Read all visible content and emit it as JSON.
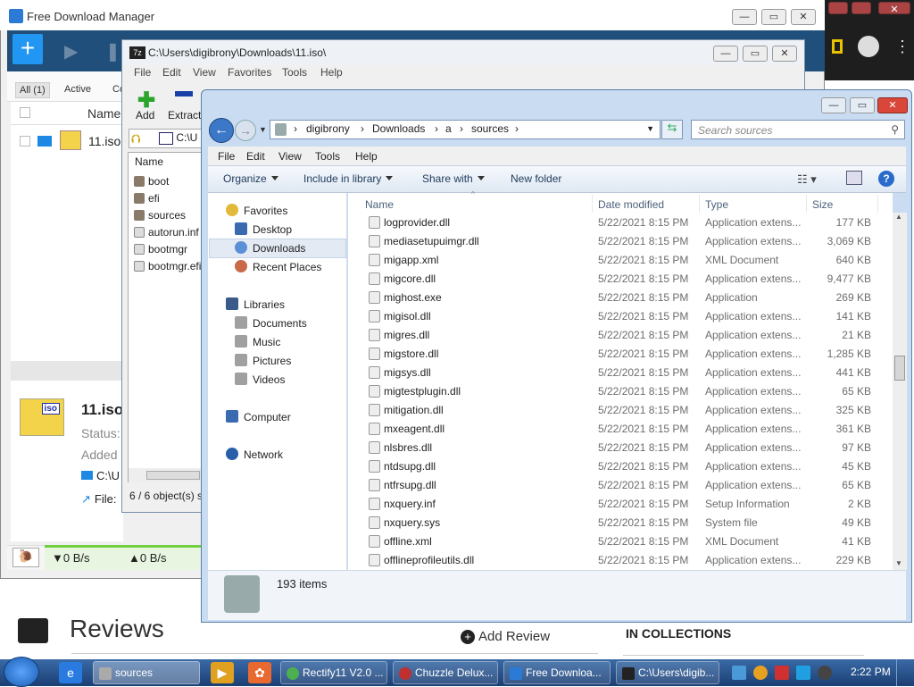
{
  "fdm": {
    "title": "Free Download Manager",
    "tabs": [
      "All (1)",
      "Active",
      "Co"
    ],
    "col_name": "Name",
    "item_name": "11.iso",
    "iso_label": "iso",
    "detail_name": "11.iso",
    "detail_status": "Status:",
    "detail_added": "Added",
    "detail_path": "C:\\U",
    "detail_file": "File:",
    "speed_down": "▼0 B/s",
    "speed_up": "▲0 B/s"
  },
  "sevenzip": {
    "title": "C:\\Users\\digibrony\\Downloads\\11.iso\\",
    "menu": [
      "File",
      "Edit",
      "View",
      "Favorites",
      "Tools",
      "Help"
    ],
    "add_label": "Add",
    "extract_label": "Extract",
    "path": "C:\\U",
    "col_name": "Name",
    "items": [
      {
        "name": "boot",
        "kind": "folder"
      },
      {
        "name": "efi",
        "kind": "folder"
      },
      {
        "name": "sources",
        "kind": "folder"
      },
      {
        "name": "autorun.inf",
        "kind": "file"
      },
      {
        "name": "bootmgr",
        "kind": "file"
      },
      {
        "name": "bootmgr.efi",
        "kind": "file"
      }
    ],
    "status": "6 / 6 object(s) s"
  },
  "explorer": {
    "breadcrumb": [
      "digibrony",
      "Downloads",
      "a",
      "sources"
    ],
    "search_placeholder": "Search sources",
    "menu": [
      "File",
      "Edit",
      "View",
      "Tools",
      "Help"
    ],
    "commands": {
      "organize": "Organize",
      "include": "Include in library",
      "share": "Share with",
      "newfolder": "New folder"
    },
    "nav": {
      "favorites": "Favorites",
      "desktop": "Desktop",
      "downloads": "Downloads",
      "recent": "Recent Places",
      "libraries": "Libraries",
      "documents": "Documents",
      "music": "Music",
      "pictures": "Pictures",
      "videos": "Videos",
      "computer": "Computer",
      "network": "Network"
    },
    "columns": {
      "name": "Name",
      "date": "Date modified",
      "type": "Type",
      "size": "Size"
    },
    "files": [
      {
        "name": "logprovider.dll",
        "date": "5/22/2021 8:15 PM",
        "type": "Application extens...",
        "size": "177 KB"
      },
      {
        "name": "mediasetupuimgr.dll",
        "date": "5/22/2021 8:15 PM",
        "type": "Application extens...",
        "size": "3,069 KB"
      },
      {
        "name": "migapp.xml",
        "date": "5/22/2021 8:15 PM",
        "type": "XML Document",
        "size": "640 KB"
      },
      {
        "name": "migcore.dll",
        "date": "5/22/2021 8:15 PM",
        "type": "Application extens...",
        "size": "9,477 KB"
      },
      {
        "name": "mighost.exe",
        "date": "5/22/2021 8:15 PM",
        "type": "Application",
        "size": "269 KB"
      },
      {
        "name": "migisol.dll",
        "date": "5/22/2021 8:15 PM",
        "type": "Application extens...",
        "size": "141 KB"
      },
      {
        "name": "migres.dll",
        "date": "5/22/2021 8:15 PM",
        "type": "Application extens...",
        "size": "21 KB"
      },
      {
        "name": "migstore.dll",
        "date": "5/22/2021 8:15 PM",
        "type": "Application extens...",
        "size": "1,285 KB"
      },
      {
        "name": "migsys.dll",
        "date": "5/22/2021 8:15 PM",
        "type": "Application extens...",
        "size": "441 KB"
      },
      {
        "name": "migtestplugin.dll",
        "date": "5/22/2021 8:15 PM",
        "type": "Application extens...",
        "size": "65 KB"
      },
      {
        "name": "mitigation.dll",
        "date": "5/22/2021 8:15 PM",
        "type": "Application extens...",
        "size": "325 KB"
      },
      {
        "name": "mxeagent.dll",
        "date": "5/22/2021 8:15 PM",
        "type": "Application extens...",
        "size": "361 KB"
      },
      {
        "name": "nlsbres.dll",
        "date": "5/22/2021 8:15 PM",
        "type": "Application extens...",
        "size": "97 KB"
      },
      {
        "name": "ntdsupg.dll",
        "date": "5/22/2021 8:15 PM",
        "type": "Application extens...",
        "size": "45 KB"
      },
      {
        "name": "ntfrsupg.dll",
        "date": "5/22/2021 8:15 PM",
        "type": "Application extens...",
        "size": "65 KB"
      },
      {
        "name": "nxquery.inf",
        "date": "5/22/2021 8:15 PM",
        "type": "Setup Information",
        "size": "2 KB"
      },
      {
        "name": "nxquery.sys",
        "date": "5/22/2021 8:15 PM",
        "type": "System file",
        "size": "49 KB"
      },
      {
        "name": "offline.xml",
        "date": "5/22/2021 8:15 PM",
        "type": "XML Document",
        "size": "41 KB"
      },
      {
        "name": "offlineprofileutils.dll",
        "date": "5/22/2021 8:15 PM",
        "type": "Application extens...",
        "size": "229 KB"
      }
    ],
    "item_count": "193 items"
  },
  "webpage": {
    "reviews_title": "Reviews",
    "add_review": "Add Review",
    "in_collections": "IN COLLECTIONS"
  },
  "taskbar": {
    "items": [
      {
        "label": "sources",
        "active": true
      },
      {
        "label": "Rectify11 V2.0 ...",
        "active": false
      },
      {
        "label": "Chuzzle Delux...",
        "active": false
      },
      {
        "label": "Free Downloa...",
        "active": false
      },
      {
        "label": "C:\\Users\\digib...",
        "active": false
      }
    ],
    "clock": "2:22 PM"
  }
}
